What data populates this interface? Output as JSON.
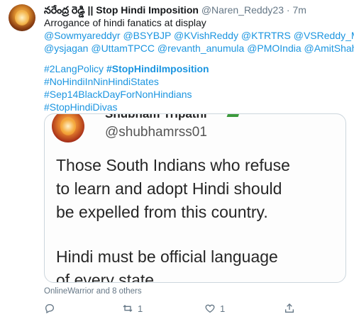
{
  "tweet": {
    "display_name": "నరేంద్ర రెడ్డి || Stop Hindi Imposition",
    "handle": "@Naren_Reddy23",
    "separator": "·",
    "time": "7m",
    "text_line1": "Arrogance of hindi fanatics at display",
    "mentions_line1": "@Sowmyareddyr @BSYBJP @KVishReddy @KTRTRS  @VSReddy_MP",
    "mentions_line2": "@ysjagan @UttamTPCC @revanth_anumula @PMOIndia @AmitShah",
    "hashtag1": "#2LangPolicy",
    "hashtag2": "#StopHindiImposition",
    "hashtag3": "#NoHindiInNinHindiStates",
    "hashtag4": "#Sep14BlackDayForNonHindians",
    "hashtag5": "#StopHindiDivas"
  },
  "media": {
    "cut_name": "Shubham Tripathi",
    "handle": "@shubhamrss01",
    "line1": "Those South Indians who refuse",
    "line2": "to learn and adopt Hindi should",
    "line3": "be expelled from this country.",
    "line4": "Hindi must be official language",
    "line5": "of every state"
  },
  "liked_by": "OnlineWarrior and 8 others",
  "actions": {
    "reply_icon": "reply-icon",
    "retweet_icon": "retweet-icon",
    "retweet_count": "1",
    "like_icon": "heart-icon",
    "like_count": "1",
    "share_icon": "share-icon"
  },
  "colors": {
    "link": "#1b95e0",
    "muted": "#657786",
    "text": "#14171a",
    "border": "#ccd6dd"
  }
}
